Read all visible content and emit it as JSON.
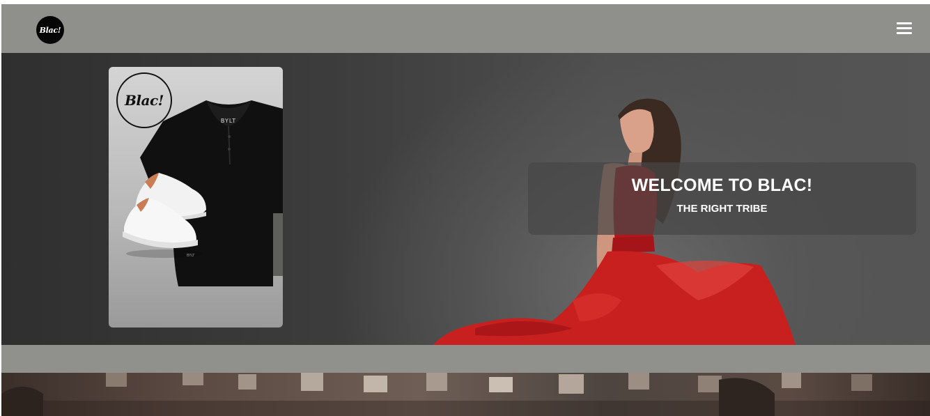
{
  "navbar": {
    "logo_text": "Blac!",
    "menu_icon": "hamburger-menu-icon",
    "background": "#8f908c"
  },
  "hero": {
    "title": "WELCOME TO BLAC!",
    "subtitle": "THE RIGHT TRIBE",
    "product_card": {
      "badge_text": "Blac!",
      "shirt_brand": "BYLT"
    },
    "dress_color": "#c8201f"
  },
  "band_color": "#90918d"
}
